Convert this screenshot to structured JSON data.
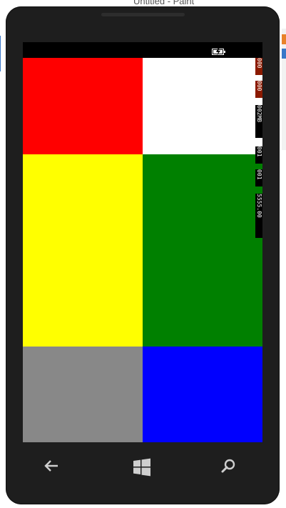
{
  "window": {
    "background_title": "Untitled - Paint"
  },
  "status_bar": {
    "battery": "battery-charging-icon"
  },
  "tiles": [
    {
      "name": "red-tile",
      "color": "#ff0000"
    },
    {
      "name": "white-tile",
      "color": "#ffffff"
    },
    {
      "name": "yellow-tile",
      "color": "#ffff00"
    },
    {
      "name": "green-tile",
      "color": "#008000"
    },
    {
      "name": "gray-tile",
      "color": "#888888"
    },
    {
      "name": "blue-tile",
      "color": "#0000ff"
    }
  ],
  "frame_counters": [
    {
      "name": "counter-1",
      "text": "000",
      "highlight": true
    },
    {
      "name": "counter-2",
      "text": "000",
      "highlight": true
    },
    {
      "name": "counter-3",
      "text": "002MB",
      "highlight": false
    },
    {
      "name": "counter-4",
      "text": "001",
      "highlight": false
    },
    {
      "name": "counter-5",
      "text": "001",
      "highlight": false
    },
    {
      "name": "counter-6",
      "text": "5555.00",
      "highlight": false
    }
  ],
  "navigation": {
    "back": "back-arrow-icon",
    "start": "windows-start-icon",
    "search": "search-icon"
  },
  "colors": {
    "phone_body": "#1e1e1e",
    "screen_background": "#000000"
  }
}
